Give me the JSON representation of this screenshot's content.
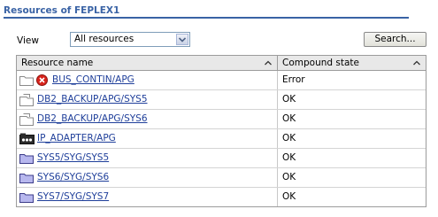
{
  "panel": {
    "title": "Resources of FEPLEX1"
  },
  "filter": {
    "view_label": "View",
    "view_selected": "All resources",
    "search_label": "Search..."
  },
  "table": {
    "columns": [
      "Resource name",
      "Compound state"
    ],
    "rows": [
      {
        "name": "BUS_CONTIN/APG",
        "state": "Error",
        "icon": "folder-icon",
        "status_icon": "error-icon"
      },
      {
        "name": "DB2_BACKUP/APG/SYS5",
        "state": "OK",
        "icon": "file-group-icon"
      },
      {
        "name": "DB2_BACKUP/APG/SYS6",
        "state": "OK",
        "icon": "file-group-icon"
      },
      {
        "name": "IP_ADAPTER/APG",
        "state": "OK",
        "icon": "adapter-icon"
      },
      {
        "name": "SYS5/SYG/SYS5",
        "state": "OK",
        "icon": "system-folder-icon"
      },
      {
        "name": "SYS6/SYG/SYS6",
        "state": "OK",
        "icon": "system-folder-icon"
      },
      {
        "name": "SYS7/SYG/SYS7",
        "state": "OK",
        "icon": "system-folder-icon"
      }
    ]
  },
  "colors": {
    "accent": "#3a63a5",
    "link": "#1f3f9a",
    "header_bg": "#e8e8e8",
    "error": "#d9241c"
  }
}
